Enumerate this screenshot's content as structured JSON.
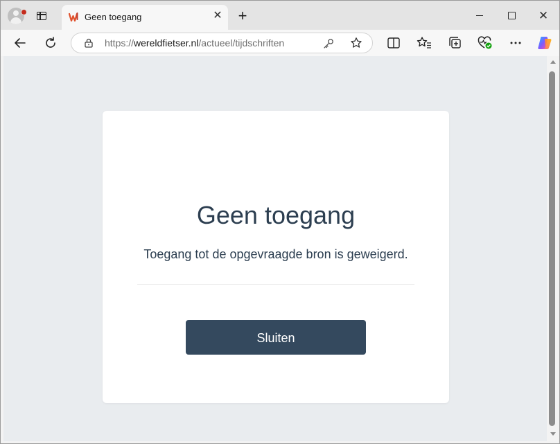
{
  "browser": {
    "tab": {
      "title": "Geen toegang"
    },
    "new_tab_symbol": "+",
    "close_symbol": "✕",
    "window_close_symbol": "✕",
    "address": {
      "scheme": "https://",
      "host": "wereldfietser.nl",
      "path": "/actueel/tijdschriften"
    },
    "icons": [
      "profile-icon",
      "tab-actions-icon",
      "favicon",
      "back-icon",
      "reload-icon",
      "lock-icon",
      "key-icon",
      "favorite-star-icon",
      "split-screen-icon",
      "favorites-icon",
      "collections-icon",
      "browser-essentials-icon",
      "more-icon",
      "copilot-icon"
    ]
  },
  "page": {
    "title": "Geen toegang",
    "message": "Toegang tot de opgevraagde bron is geweigerd.",
    "close_label": "Sluiten"
  },
  "colors": {
    "background": "#e9ecef",
    "card": "#ffffff",
    "text": "#2c3e50",
    "button": "#34495e",
    "button_text": "#ffffff"
  }
}
